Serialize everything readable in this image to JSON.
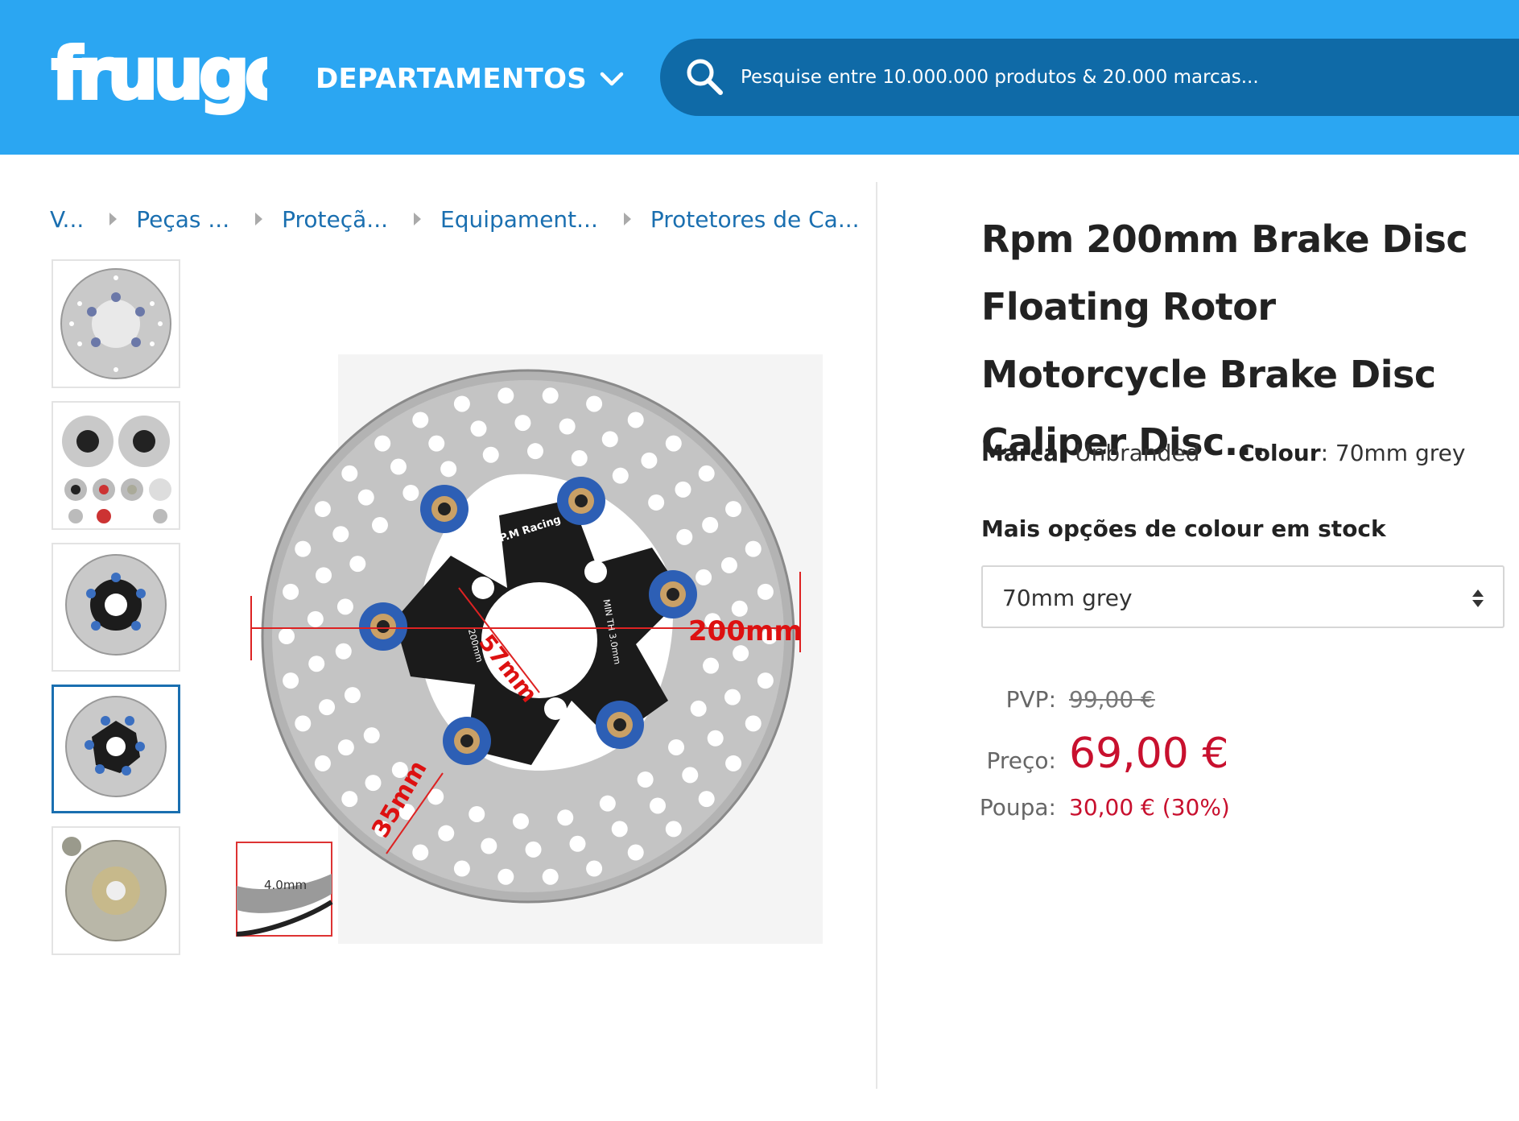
{
  "header": {
    "logo_text": "fruugo",
    "departments_label": "DEPARTAMENTOS",
    "search_placeholder": "Pesquise entre 10.000.000 produtos & 20.000 marcas..."
  },
  "breadcrumb": [
    "V...",
    "Peças ...",
    "Proteçã...",
    "Equipament...",
    "Protetores de Ca..."
  ],
  "gallery": {
    "thumbnail_count": 5,
    "active_thumbnail": 4,
    "main_image_labels": {
      "brand_text": "R.P.M Racing",
      "dim_outer": "200mm",
      "dim_inner": "57mm",
      "dim_hole": "35mm",
      "thickness": "4.0mm",
      "min_th": "MIN TH 3.0mm",
      "size_small": "200mm"
    }
  },
  "product": {
    "title": "Rpm 200mm Brake Disc Floating Rotor Motorcycle Brake Disc Caliper Disc...",
    "brand_label": "Marca:",
    "brand_value": "Unbranded",
    "colour_label": "Colour",
    "colour_value": "70mm grey",
    "more_options_label": "Mais opções de colour em stock",
    "selected_option": "70mm grey",
    "pvp_label": "PVP:",
    "pvp_value": "99,00 €",
    "price_label": "Preço:",
    "price_value": "69,00 €",
    "save_label": "Poupa:",
    "save_value": "30,00 € (30%)"
  },
  "colors": {
    "header_bg": "#2ba6f2",
    "search_bg": "#0f6aa7",
    "link": "#1a6fb0",
    "price": "#c8102e"
  }
}
